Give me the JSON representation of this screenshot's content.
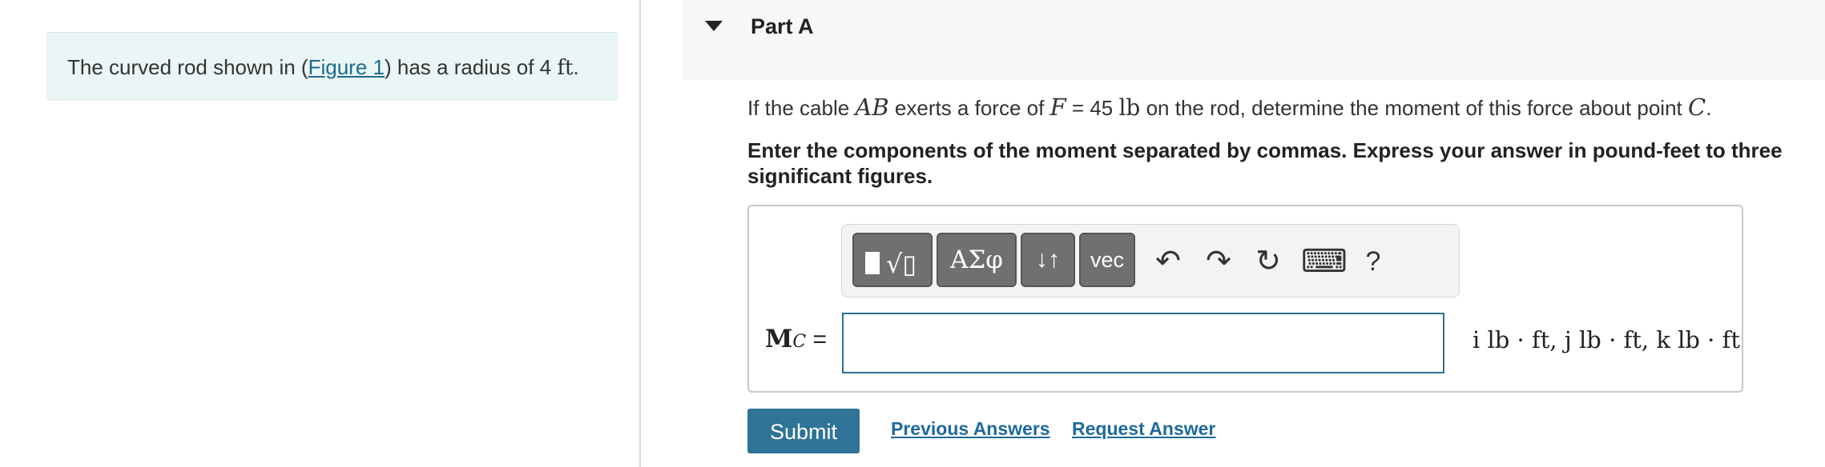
{
  "left_panel": {
    "intro_prefix": "The curved rod shown in (",
    "figure_link": "Figure 1",
    "intro_middle": ") has a radius of 4 ",
    "intro_unit": "ft",
    "intro_suffix": "."
  },
  "part": {
    "title": "Part A"
  },
  "question": {
    "t1": "If the cable ",
    "m1": "AB",
    "t2": " exerts a force of ",
    "m2": "F",
    "t3": " = 45 ",
    "u1": "lb",
    "t4": " on the rod, determine the moment of this force about point ",
    "m3": "C",
    "t5": "."
  },
  "instructions": "Enter the components of the moment separated by commas. Express your answer in pound-feet to three significant figures.",
  "toolbar": {
    "templates_glyph": "√▯",
    "greek_label": "ΑΣφ",
    "arrows_label": "↓↑",
    "vec_label": "vec",
    "undo_glyph": "↶",
    "redo_glyph": "↷",
    "reset_glyph": "↻",
    "keyboard_glyph": "⌨",
    "help_label": "?"
  },
  "answer": {
    "label_main": "M",
    "label_sub": "C",
    "label_eq": " =",
    "value": "",
    "units": "i lb · ft, j lb · ft, k lb · ft"
  },
  "actions": {
    "submit_label": "Submit",
    "previous_answers": "Previous Answers",
    "request_answer": "Request Answer"
  },
  "colors": {
    "accent": "#2f7396",
    "link": "#1d6a9c",
    "intro_bg": "#eaf5f5",
    "toolbar_button": "#707070"
  }
}
